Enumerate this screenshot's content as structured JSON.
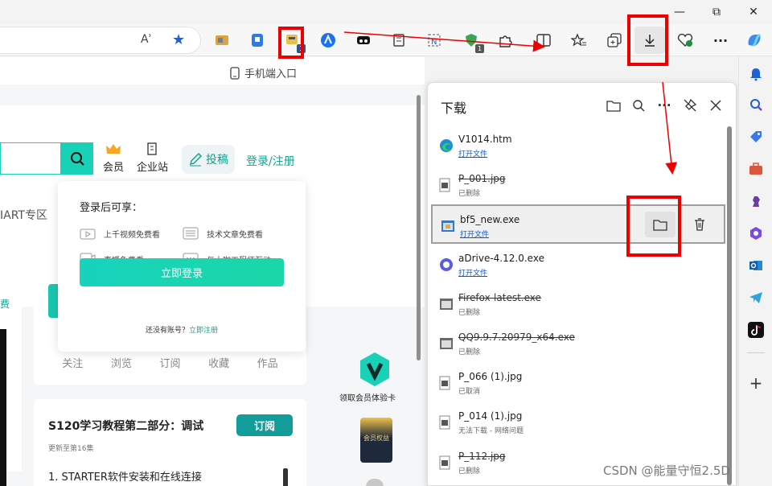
{
  "titlebar": {
    "minimize": "—",
    "maximize": "⧉",
    "close": "✕"
  },
  "toolbar": {
    "read_aloud": "Aʾ",
    "favorite": "★",
    "badge_one": "1",
    "badge_two": "1",
    "more": "···"
  },
  "page": {
    "mobile_entry": "手机端入口",
    "member": "会员",
    "enterprise": "企业站",
    "post": "投稿",
    "login_register": "登录/注册",
    "zone_text": "IART专区",
    "left_edge_text": "费",
    "login_popup": {
      "title": "登录后可享：",
      "benefits": [
        "上千视频免费看",
        "技术文章免费看",
        "直播免费看",
        "与大咖工程师互动"
      ],
      "login_button": "立即登录",
      "no_account": "还没有账号？",
      "register_link": "立即注册"
    },
    "stats": [
      "关注",
      "浏览",
      "订阅",
      "收藏",
      "作品"
    ],
    "vip_label": "领取会员体验卡",
    "vip_badge": "会员权益",
    "course": {
      "title": "S120学习教程第二部分：调试",
      "subscribe": "订阅",
      "updated": "更新至第16集",
      "chapter": "1. STARTER软件安装和在线连接"
    }
  },
  "downloads": {
    "title": "下载",
    "items": [
      {
        "name": "V1014.htm",
        "status": "打开文件",
        "link": true,
        "strike": false,
        "icon": "edge"
      },
      {
        "name": "P_001.jpg",
        "status": "已删除",
        "link": false,
        "strike": true,
        "icon": "image"
      },
      {
        "name": "bf5_new.exe",
        "status": "打开文件",
        "link": true,
        "strike": false,
        "icon": "exe",
        "selected": true
      },
      {
        "name": "aDrive-4.12.0.exe",
        "status": "打开文件",
        "link": true,
        "strike": false,
        "icon": "adrive"
      },
      {
        "name": "Firefox-latest.exe",
        "status": "已删除",
        "link": false,
        "strike": true,
        "icon": "exe-gray"
      },
      {
        "name": "QQ9.9.7.20979_x64.exe",
        "status": "已删除",
        "link": false,
        "strike": true,
        "icon": "exe-gray"
      },
      {
        "name": "P_066 (1).jpg",
        "status": "已取消",
        "link": false,
        "strike": false,
        "icon": "image"
      },
      {
        "name": "P_014 (1).jpg",
        "status": "无法下载 - 网络问题",
        "link": false,
        "strike": false,
        "icon": "image"
      },
      {
        "name": "P_112.jpg",
        "status": "已删除",
        "link": false,
        "strike": true,
        "icon": "image"
      }
    ]
  },
  "watermark": "CSDN @能量守恒2.5D",
  "colors": {
    "accent": "#0c65d6",
    "teal": "#19d1b6",
    "annotation": "#ef0000"
  }
}
